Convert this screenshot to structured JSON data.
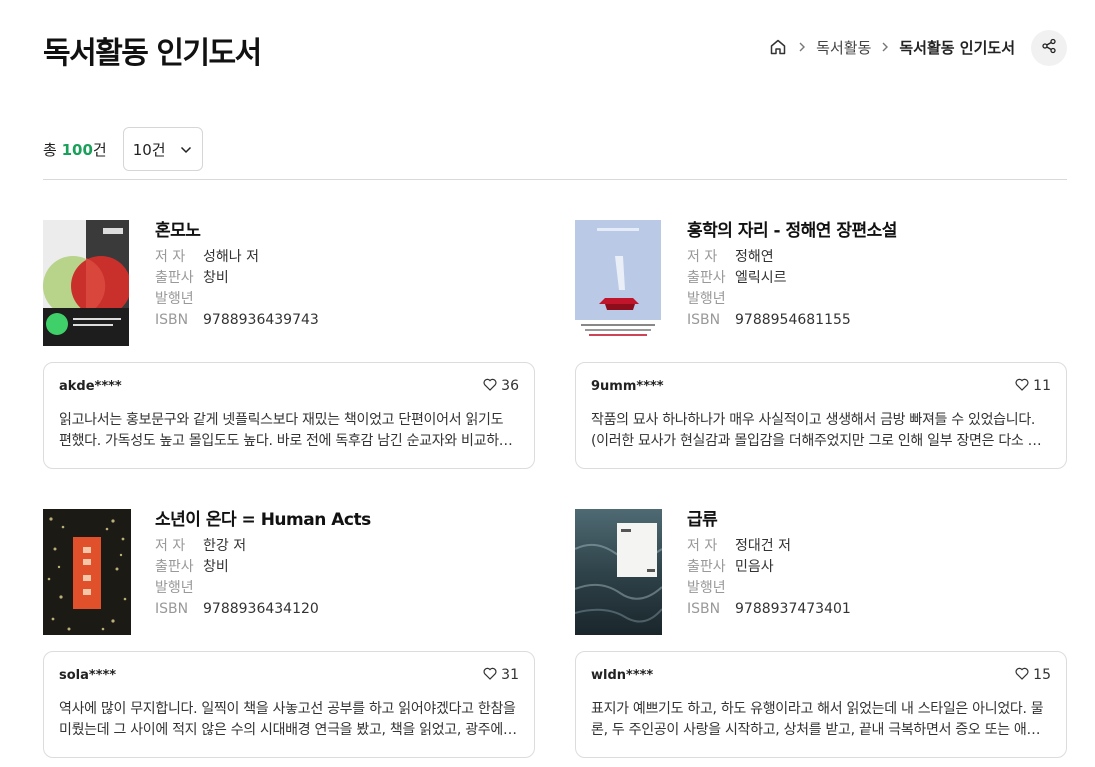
{
  "header": {
    "title": "독서활동 인기도서",
    "breadcrumb": [
      "독서활동",
      "독서활동 인기도서"
    ]
  },
  "summary": {
    "prefix": "총 ",
    "count": "100",
    "suffix": "건",
    "page_size": "10건"
  },
  "meta_labels": {
    "author": "저 자",
    "publisher": "출판사",
    "year": "발행년",
    "isbn": "ISBN"
  },
  "books": [
    {
      "title": "혼모노",
      "author": "성해나 저",
      "publisher": "창비",
      "year": "",
      "isbn": "9788936439743",
      "review": {
        "user": "akde****",
        "likes": "36",
        "text": "읽고나서는 홍보문구와 같게 넷플릭스보다 재밌는 책이었고 단편이어서 읽기도 편했다. 가독성도 높고 몰입도도 높다. 바로 전에 독후감 남긴 순교자와 비교하면 훨씬 가볍게 읽을 수 있었다."
      }
    },
    {
      "title": "홍학의 자리 - 정해연 장편소설",
      "author": "정해연",
      "publisher": "엘릭시르",
      "year": "",
      "isbn": "9788954681155",
      "review": {
        "user": "9umm****",
        "likes": "11",
        "text": "작품의 묘사 하나하나가 매우 사실적이고 생생해서 금방 빠져들 수 있었습니다. (이러한 묘사가 현실감과 몰입감을 더해주었지만 그로 인해 일부 장면은 다소 불편하게 느껴지기도 했습니다."
      }
    },
    {
      "title": "소년이 온다 = Human Acts",
      "author": "한강 저",
      "publisher": "창비",
      "year": "",
      "isbn": "9788936434120",
      "review": {
        "user": "sola****",
        "likes": "31",
        "text": "역사에 많이 무지합니다. 일찍이 책을 사놓고선 공부를 하고 읽어야겠다고 한참을 미뤘는데 그 사이에 적지 않은 수의 시대배경 연극을 봤고, 책을 읽었고, 광주에 다녀오기도 했습니다."
      }
    },
    {
      "title": "급류",
      "author": "정대건 저",
      "publisher": "민음사",
      "year": "",
      "isbn": "9788937473401",
      "review": {
        "user": "wldn****",
        "likes": "15",
        "text": "표지가 예쁘기도 하고, 하도 유행이라고 해서 읽었는데 내 스타일은 아니었다. 물론, 두 주인공이 사랑을 시작하고, 상처를 받고, 끝내 극복하면서 증오 또는 애정을 보여주는 이야기였다."
      }
    }
  ],
  "colors": {
    "accent": "#1aa05a",
    "border": "#dcdcdc",
    "label": "#999999"
  },
  "icons": [
    "home-icon",
    "chevron-right-icon",
    "share-icon",
    "chevron-down-icon",
    "heart-icon"
  ]
}
